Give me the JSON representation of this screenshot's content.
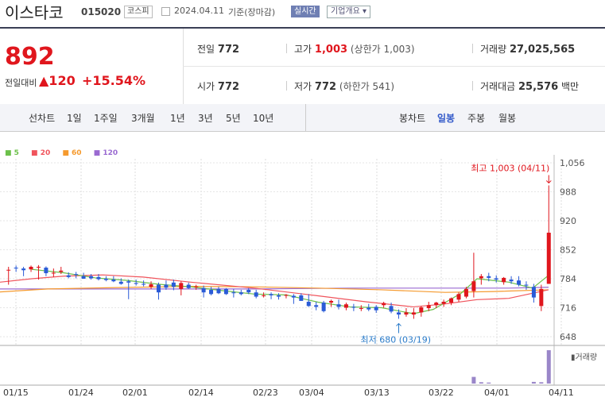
{
  "header": {
    "name": "이스타코",
    "code": "015020",
    "market": "코스피",
    "date": "2024.04.11",
    "basis": "기준(장마감)",
    "realtime": "실시간",
    "company": "기업개요 ▾"
  },
  "summary": {
    "price": "892",
    "change_label": "전일대비",
    "change": "▲120",
    "change_pct": "+15.54%",
    "prev_label": "전일",
    "prev": "772",
    "high_label": "고가",
    "high": "1,003",
    "high_sub": "(상한가 1,003)",
    "volume_label": "거래량",
    "volume": "27,025,565",
    "open_label": "시가",
    "open": "772",
    "low_label": "저가",
    "low": "772",
    "low_sub": "(하한가 541)",
    "amount_label": "거래대금",
    "amount": "25,576",
    "amount_unit": "백만"
  },
  "tabs": {
    "line_label": "선차트",
    "periods": [
      "1일",
      "1주일",
      "3개월",
      "1년",
      "3년",
      "5년",
      "10년"
    ],
    "candle_label": "봉차트",
    "candles": [
      "일봉",
      "주봉",
      "월봉"
    ],
    "active_candle": 0
  },
  "colors": {
    "up": "#e0161d",
    "down": "#2a5bd7",
    "ma5": "#6cc04a",
    "ma20": "#f0545c",
    "ma60": "#f59a2e",
    "ma120": "#9a6ad1",
    "volume": "#9a86c9"
  },
  "chart_data": {
    "type": "candlestick",
    "legend": [
      "5",
      "20",
      "60",
      "120"
    ],
    "y_ticks": [
      1056,
      988,
      920,
      852,
      784,
      716,
      648
    ],
    "ylim": [
      648,
      1056
    ],
    "x_ticks": [
      "01/15",
      "01/24",
      "02/01",
      "02/14",
      "02/23",
      "03/04",
      "03/13",
      "03/22",
      "04/01",
      "04/11"
    ],
    "volume_label": "거래량",
    "annotations": {
      "high": "최고 1,003 (04/11)",
      "low": "최저 680 (03/19)"
    },
    "candles": [
      [
        805,
        812,
        770,
        805
      ],
      [
        810,
        815,
        800,
        808
      ],
      [
        808,
        812,
        790,
        804
      ],
      [
        806,
        815,
        800,
        812
      ],
      [
        812,
        816,
        782,
        812
      ],
      [
        810,
        813,
        790,
        797
      ],
      [
        798,
        808,
        788,
        798
      ],
      [
        800,
        812,
        795,
        803
      ],
      [
        792,
        799,
        785,
        788
      ],
      [
        795,
        800,
        785,
        794
      ],
      [
        790,
        798,
        784,
        784
      ],
      [
        790,
        795,
        782,
        785
      ],
      [
        788,
        795,
        780,
        783
      ],
      [
        784,
        790,
        778,
        781
      ],
      [
        782,
        790,
        776,
        778
      ],
      [
        777,
        785,
        770,
        772
      ],
      [
        778,
        782,
        736,
        775
      ],
      [
        774,
        782,
        768,
        772
      ],
      [
        772,
        780,
        766,
        770
      ],
      [
        765,
        778,
        760,
        771
      ],
      [
        770,
        775,
        735,
        752
      ],
      [
        770,
        780,
        758,
        763
      ],
      [
        775,
        782,
        757,
        765
      ],
      [
        760,
        778,
        745,
        774
      ],
      [
        770,
        775,
        760,
        762
      ],
      [
        765,
        770,
        758,
        766
      ],
      [
        762,
        768,
        740,
        752
      ],
      [
        758,
        765,
        745,
        748
      ],
      [
        760,
        765,
        748,
        750
      ],
      [
        760,
        762,
        746,
        748
      ],
      [
        752,
        760,
        740,
        750
      ],
      [
        752,
        758,
        745,
        748
      ],
      [
        758,
        762,
        748,
        752
      ],
      [
        752,
        758,
        738,
        742
      ],
      [
        745,
        752,
        740,
        745
      ],
      [
        748,
        752,
        736,
        745
      ],
      [
        745,
        750,
        735,
        742
      ],
      [
        744,
        748,
        738,
        746
      ],
      [
        744,
        748,
        725,
        740
      ],
      [
        745,
        750,
        735,
        732
      ],
      [
        730,
        748,
        718,
        720
      ],
      [
        722,
        730,
        710,
        718
      ],
      [
        728,
        732,
        705,
        708
      ],
      [
        728,
        735,
        718,
        732
      ],
      [
        724,
        735,
        712,
        718
      ],
      [
        716,
        728,
        710,
        724
      ],
      [
        718,
        725,
        708,
        716
      ],
      [
        714,
        722,
        708,
        715
      ],
      [
        716,
        725,
        708,
        712
      ],
      [
        718,
        722,
        704,
        710
      ],
      [
        722,
        730,
        716,
        727
      ],
      [
        720,
        728,
        703,
        707
      ],
      [
        705,
        712,
        690,
        700
      ],
      [
        700,
        715,
        695,
        705
      ],
      [
        700,
        715,
        690,
        705
      ],
      [
        705,
        720,
        695,
        717
      ],
      [
        715,
        730,
        708,
        722
      ],
      [
        722,
        730,
        715,
        728
      ],
      [
        725,
        735,
        718,
        730
      ],
      [
        728,
        740,
        722,
        738
      ],
      [
        735,
        752,
        730,
        748
      ],
      [
        742,
        765,
        738,
        760
      ],
      [
        755,
        845,
        740,
        778
      ],
      [
        785,
        795,
        770,
        790
      ],
      [
        790,
        798,
        778,
        786
      ],
      [
        785,
        792,
        775,
        782
      ],
      [
        776,
        788,
        770,
        786
      ],
      [
        782,
        790,
        772,
        778
      ],
      [
        780,
        790,
        766,
        770
      ],
      [
        770,
        778,
        758,
        768
      ],
      [
        765,
        772,
        728,
        740
      ],
      [
        720,
        770,
        708,
        760
      ],
      [
        772,
        1003,
        772,
        892
      ]
    ],
    "ma5": [
      [
        40,
        806
      ],
      [
        80,
        798
      ],
      [
        120,
        786
      ],
      [
        160,
        780
      ],
      [
        200,
        771
      ],
      [
        240,
        765
      ],
      [
        280,
        756
      ],
      [
        320,
        748
      ],
      [
        360,
        746
      ],
      [
        400,
        729
      ],
      [
        440,
        718
      ],
      [
        480,
        716
      ],
      [
        520,
        702
      ],
      [
        545,
        712
      ],
      [
        580,
        750
      ],
      [
        600,
        784
      ],
      [
        640,
        776
      ],
      [
        670,
        762
      ],
      [
        690,
        792
      ]
    ],
    "ma20": [
      [
        0,
        776
      ],
      [
        40,
        784
      ],
      [
        80,
        790
      ],
      [
        130,
        793
      ],
      [
        180,
        788
      ],
      [
        240,
        776
      ],
      [
        320,
        762
      ],
      [
        400,
        744
      ],
      [
        460,
        730
      ],
      [
        520,
        718
      ],
      [
        560,
        725
      ],
      [
        600,
        735
      ],
      [
        640,
        738
      ],
      [
        690,
        758
      ]
    ],
    "ma60": [
      [
        0,
        753
      ],
      [
        60,
        760
      ],
      [
        140,
        763
      ],
      [
        240,
        766
      ],
      [
        320,
        765
      ],
      [
        400,
        762
      ],
      [
        480,
        758
      ],
      [
        560,
        752
      ],
      [
        620,
        754
      ],
      [
        690,
        758
      ]
    ],
    "ma120": [
      [
        0,
        760
      ],
      [
        80,
        760
      ],
      [
        200,
        760
      ],
      [
        320,
        760
      ],
      [
        440,
        762
      ],
      [
        560,
        762
      ],
      [
        640,
        762
      ],
      [
        690,
        764
      ]
    ],
    "volume": [
      0,
      0,
      0,
      0,
      0,
      0,
      0,
      0,
      0,
      0,
      0,
      0,
      0,
      0,
      0,
      0,
      0,
      0,
      0,
      0,
      0,
      0,
      0,
      0,
      0,
      0,
      0,
      0,
      0,
      0,
      0,
      0,
      0,
      0,
      0,
      0,
      0,
      0,
      0,
      0,
      0,
      0,
      0,
      0,
      0,
      0,
      0,
      0,
      0,
      0,
      0,
      0,
      0,
      0,
      0,
      0,
      0,
      0,
      0,
      0,
      0,
      0,
      0.2,
      0.04,
      0.03,
      0,
      0,
      0,
      0,
      0,
      0.05,
      0.04,
      1
    ]
  }
}
